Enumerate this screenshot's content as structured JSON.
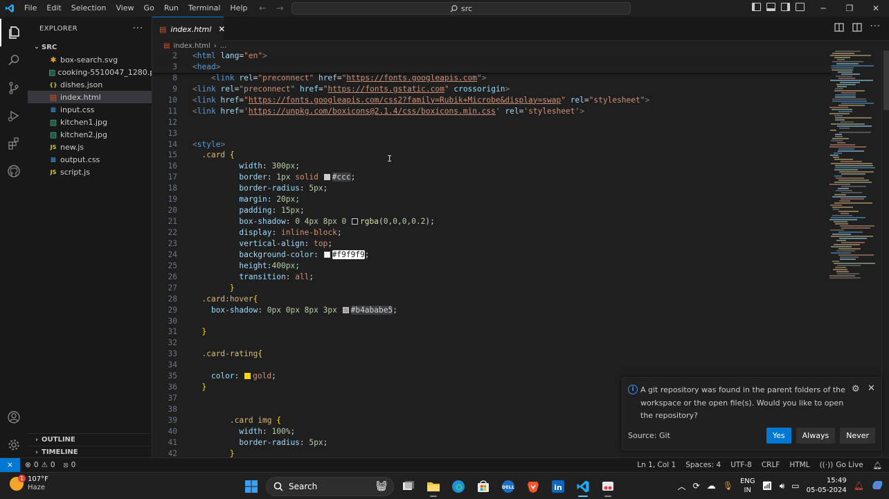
{
  "titlebar": {
    "menu": [
      "File",
      "Edit",
      "Selection",
      "View",
      "Go",
      "Run",
      "Terminal",
      "Help"
    ],
    "search": "src"
  },
  "explorer": {
    "title": "EXPLORER",
    "folder": "SRC",
    "files": [
      {
        "name": "box-search.svg",
        "icon": "svg-icon",
        "color": "#e8a33d"
      },
      {
        "name": "cooking-5510047_1280.p...",
        "icon": "image-icon",
        "color": "#41b883"
      },
      {
        "name": "dishes.json",
        "icon": "json-icon",
        "color": "#cbcb41"
      },
      {
        "name": "index.html",
        "icon": "html-icon",
        "color": "#e44d26"
      },
      {
        "name": "input.css",
        "icon": "css-icon",
        "color": "#42a5f5"
      },
      {
        "name": "kitchen1.jpg",
        "icon": "image-icon",
        "color": "#41b883"
      },
      {
        "name": "kitchen2.jpg",
        "icon": "image-icon",
        "color": "#41b883"
      },
      {
        "name": "new.js",
        "icon": "js-icon",
        "color": "#cbcb41"
      },
      {
        "name": "output.css",
        "icon": "css-icon",
        "color": "#42a5f5"
      },
      {
        "name": "script.js",
        "icon": "js-icon",
        "color": "#cbcb41"
      }
    ],
    "outline": "OUTLINE",
    "timeline": "TIMELINE"
  },
  "editor": {
    "tab": "index.html",
    "breadcrumb_file": "index.html",
    "breadcrumb_rest": "..."
  },
  "code": {
    "l2": "2",
    "l3": "3",
    "l8": "8",
    "l9": "9",
    "l10": "10",
    "l11": "11",
    "l12": "12",
    "l13": "13",
    "l14": "14",
    "l15": "15",
    "l16": "16",
    "l17": "17",
    "l18": "18",
    "l19": "19",
    "l20": "20",
    "l21": "21",
    "l22": "22",
    "l23": "23",
    "l24": "24",
    "l25": "25",
    "l26": "26",
    "l27": "27",
    "l28": "28",
    "l29": "29",
    "l30": "30",
    "l31": "31",
    "l32": "32",
    "l33": "33",
    "l34": "34",
    "l35": "35",
    "l36": "36",
    "l37": "37",
    "l38": "38",
    "l39": "39",
    "l40": "40",
    "l41": "41",
    "l42": "42",
    "url_preconnect1": "https://fonts.googleapis.com",
    "url_preconnect2": "https://fonts.gstatic.com",
    "url_fonts_css": "https://fonts.googleapis.com/css2?family=Rubik+Microbe&display=swap",
    "url_boxicons": "https://unpkg.com/boxicons@2.1.4/css/boxicons.min.css",
    "color_ccc": "#ccc",
    "color_f9": "#f9f9f9",
    "color_b4": "#b4ababe5",
    "color_gold": "gold"
  },
  "notification": {
    "message": "A git repository was found in the parent folders of the workspace or the open file(s). Would you like to open the repository?",
    "source": "Source: Git",
    "yes": "Yes",
    "always": "Always",
    "never": "Never"
  },
  "statusbar": {
    "errors": "0",
    "warnings": "0",
    "ports": "0",
    "position": "Ln 1, Col 1",
    "spaces": "Spaces: 4",
    "encoding": "UTF-8",
    "eol": "CRLF",
    "language": "HTML",
    "golive": "Go Live"
  },
  "taskbar": {
    "temp": "107°F",
    "weather": "Haze",
    "badge": "1",
    "search": "Search",
    "lang1": "ENG",
    "lang2": "IN",
    "time": "15:49",
    "date": "05-05-2024"
  }
}
